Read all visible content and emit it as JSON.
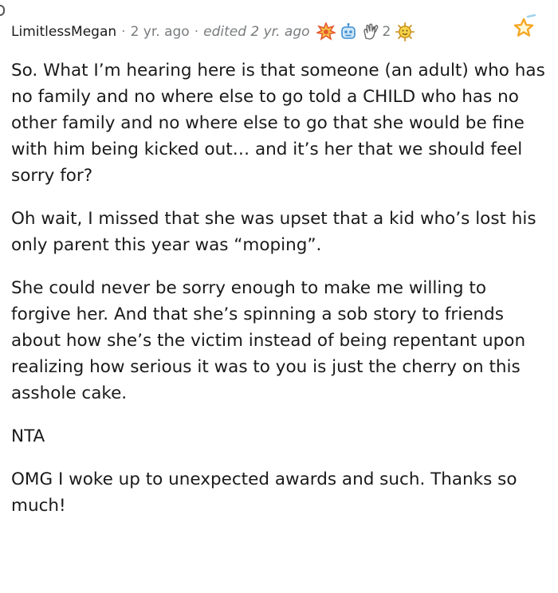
{
  "comment": {
    "author": "LimitlessMegan",
    "separator": "·",
    "time_ago": "2 yr. ago",
    "edited": "edited 2 yr. ago",
    "awards": [
      {
        "icon": "starburst-award-icon",
        "color": "#e4572e"
      },
      {
        "icon": "robot-award-icon",
        "color": "#3d8fd1"
      },
      {
        "icon": "clapping-hands-award-icon",
        "color": "#888888"
      },
      {
        "icon": "sun-face-award-icon",
        "color": "#f2b632"
      }
    ],
    "award_count": "2",
    "give_award_icon": "star-outline-icon",
    "paragraphs": [
      "So. What I’m hearing here is that someone (an adult) who has no family and no where else to go told a CHILD who has no other family and no where else to go that she would be fine with him being kicked out… and it’s her that we should feel sorry for?",
      "Oh wait, I missed that she was upset that a kid who’s lost his only parent this year was “moping”.",
      "She could never be sorry enough to make me willing to forgive her. And that she’s spinning a sob story to friends about how she’s the victim instead of being repentant upon realizing how serious it was to you is just the cherry on this asshole cake.",
      "NTA",
      "OMG I woke up to unexpected awards and such. Thanks so much!"
    ]
  }
}
